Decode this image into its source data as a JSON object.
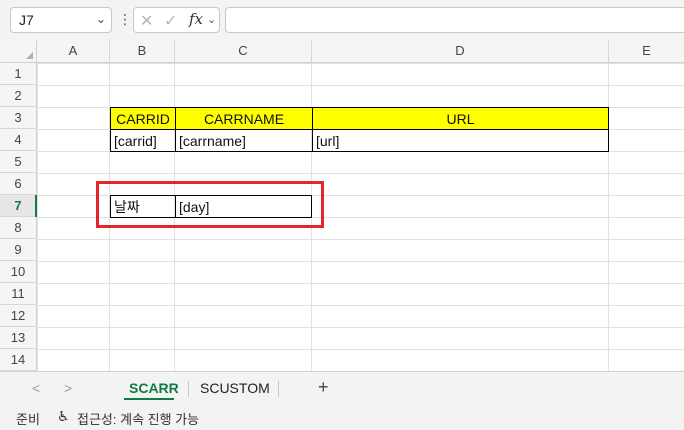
{
  "formula_bar": {
    "name_box": "J7",
    "cancel_icon": "x-icon",
    "enter_icon": "check-icon",
    "fx_label": "fx",
    "formula": ""
  },
  "columns": [
    "A",
    "B",
    "C",
    "D",
    "E"
  ],
  "rows": [
    "1",
    "2",
    "3",
    "4",
    "5",
    "6",
    "7",
    "8",
    "9",
    "10",
    "11",
    "12",
    "13",
    "14"
  ],
  "active_row": "7",
  "cells": {
    "B3": "CARRID",
    "C3": "CARRNAME",
    "D3": "URL",
    "B4": "[carrid]",
    "C4": "[carrname]",
    "D4": "[url]",
    "B7": "날짜",
    "C7": "[day]"
  },
  "header_fill_color": "#ffff00",
  "highlight_color": "#e3262b",
  "sheet_tabs": {
    "prev": "<",
    "next": ">",
    "tabs": [
      "SCARR",
      "SCUSTOM"
    ],
    "active": "SCARR",
    "add": "+"
  },
  "status_bar": {
    "ready": "준비",
    "accessibility": "접근성: 계속 진행 가능"
  }
}
